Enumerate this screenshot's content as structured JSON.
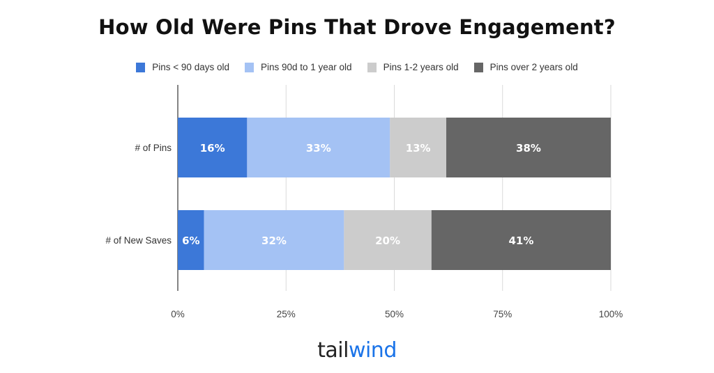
{
  "chart_data": {
    "type": "bar",
    "orientation": "horizontal",
    "stacked": "percent",
    "title": "How Old Were Pins That Drove Engagement?",
    "categories": [
      "# of Pins",
      "# of New Saves"
    ],
    "series": [
      {
        "name": "Pins < 90 days old",
        "color": "#3c78d8",
        "values": [
          16,
          6
        ],
        "labels": [
          "16%",
          "6%"
        ]
      },
      {
        "name": "Pins 90d to 1 year old",
        "color": "#a4c2f4",
        "values": [
          33,
          32
        ],
        "labels": [
          "33%",
          "32%"
        ]
      },
      {
        "name": "Pins 1-2 years old",
        "color": "#cccccc",
        "values": [
          13,
          20
        ],
        "labels": [
          "13%",
          "20%"
        ]
      },
      {
        "name": "Pins over 2 years old",
        "color": "#666666",
        "values": [
          38,
          41
        ],
        "labels": [
          "38%",
          "41%"
        ]
      }
    ],
    "xlim": [
      0,
      100
    ],
    "xticks": [
      "0%",
      "25%",
      "50%",
      "75%",
      "100%"
    ],
    "xlabel": "",
    "ylabel": "",
    "grid": true,
    "legend_position": "top"
  },
  "brand": {
    "part1": "tail",
    "part2": "wind"
  }
}
